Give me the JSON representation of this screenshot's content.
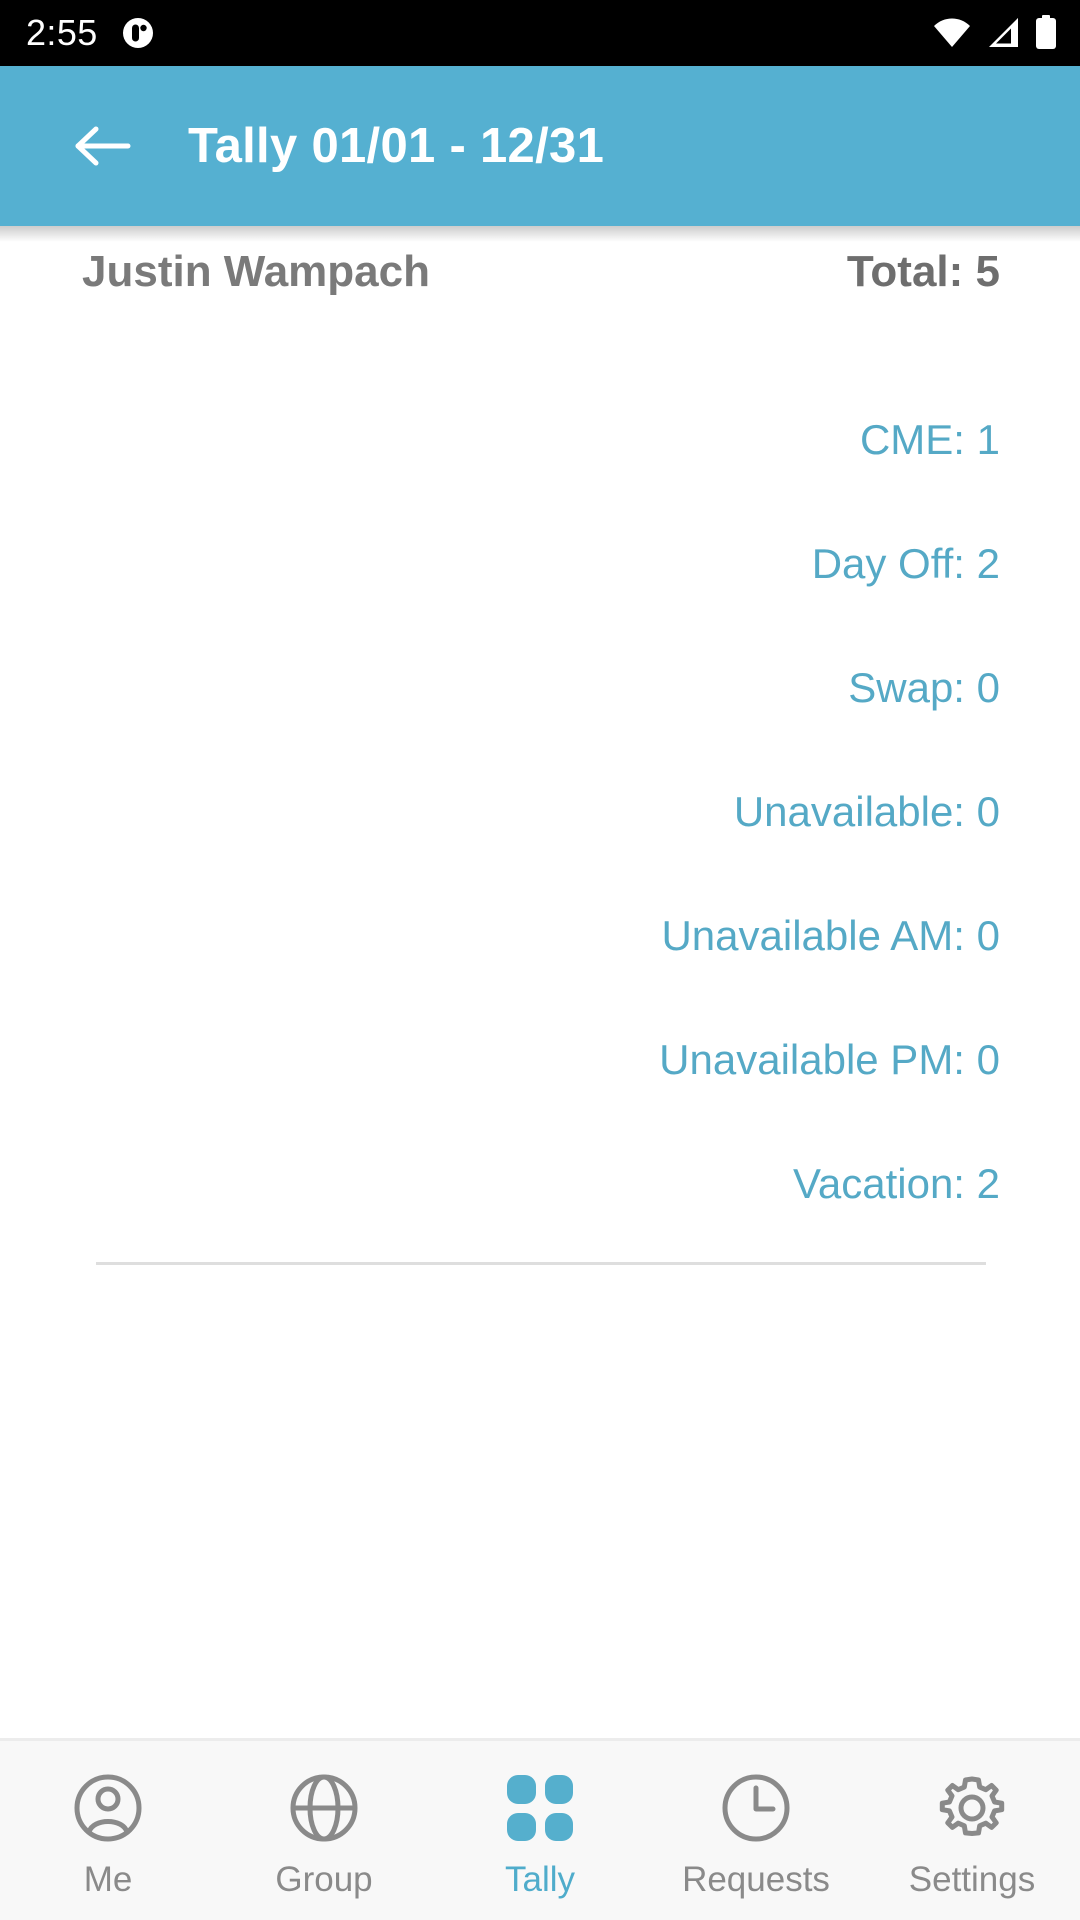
{
  "status_bar": {
    "time": "2:55",
    "notification_icon": "app-notification-icon",
    "wifi_icon": "wifi-icon",
    "signal_icon": "cell-signal-icon",
    "battery_icon": "battery-full-icon",
    "background": "#000000"
  },
  "appbar": {
    "back_icon": "back-arrow-icon",
    "title": "Tally 01/01 - 12/31",
    "background": "#55B0D1",
    "title_color": "#ffffff"
  },
  "tally": {
    "provider_name": "Justin Wampach",
    "total_label": "Total: 5",
    "accent_color": "#55A9C6",
    "rows": [
      {
        "label": "CME: 1"
      },
      {
        "label": "Day Off: 2"
      },
      {
        "label": "Swap: 0"
      },
      {
        "label": "Unavailable: 0"
      },
      {
        "label": "Unavailable AM: 0"
      },
      {
        "label": "Unavailable PM: 0"
      },
      {
        "label": "Vacation: 2"
      }
    ]
  },
  "bottom_nav": {
    "active_color": "#4FACCB",
    "inactive_color": "#8a8a8a",
    "items": [
      {
        "label": "Me",
        "icon": "person-circle-icon",
        "active": false
      },
      {
        "label": "Group",
        "icon": "globe-icon",
        "active": false
      },
      {
        "label": "Tally",
        "icon": "grid-squares-icon",
        "active": true
      },
      {
        "label": "Requests",
        "icon": "clock-icon",
        "active": false
      },
      {
        "label": "Settings",
        "icon": "gear-icon",
        "active": false
      }
    ]
  }
}
